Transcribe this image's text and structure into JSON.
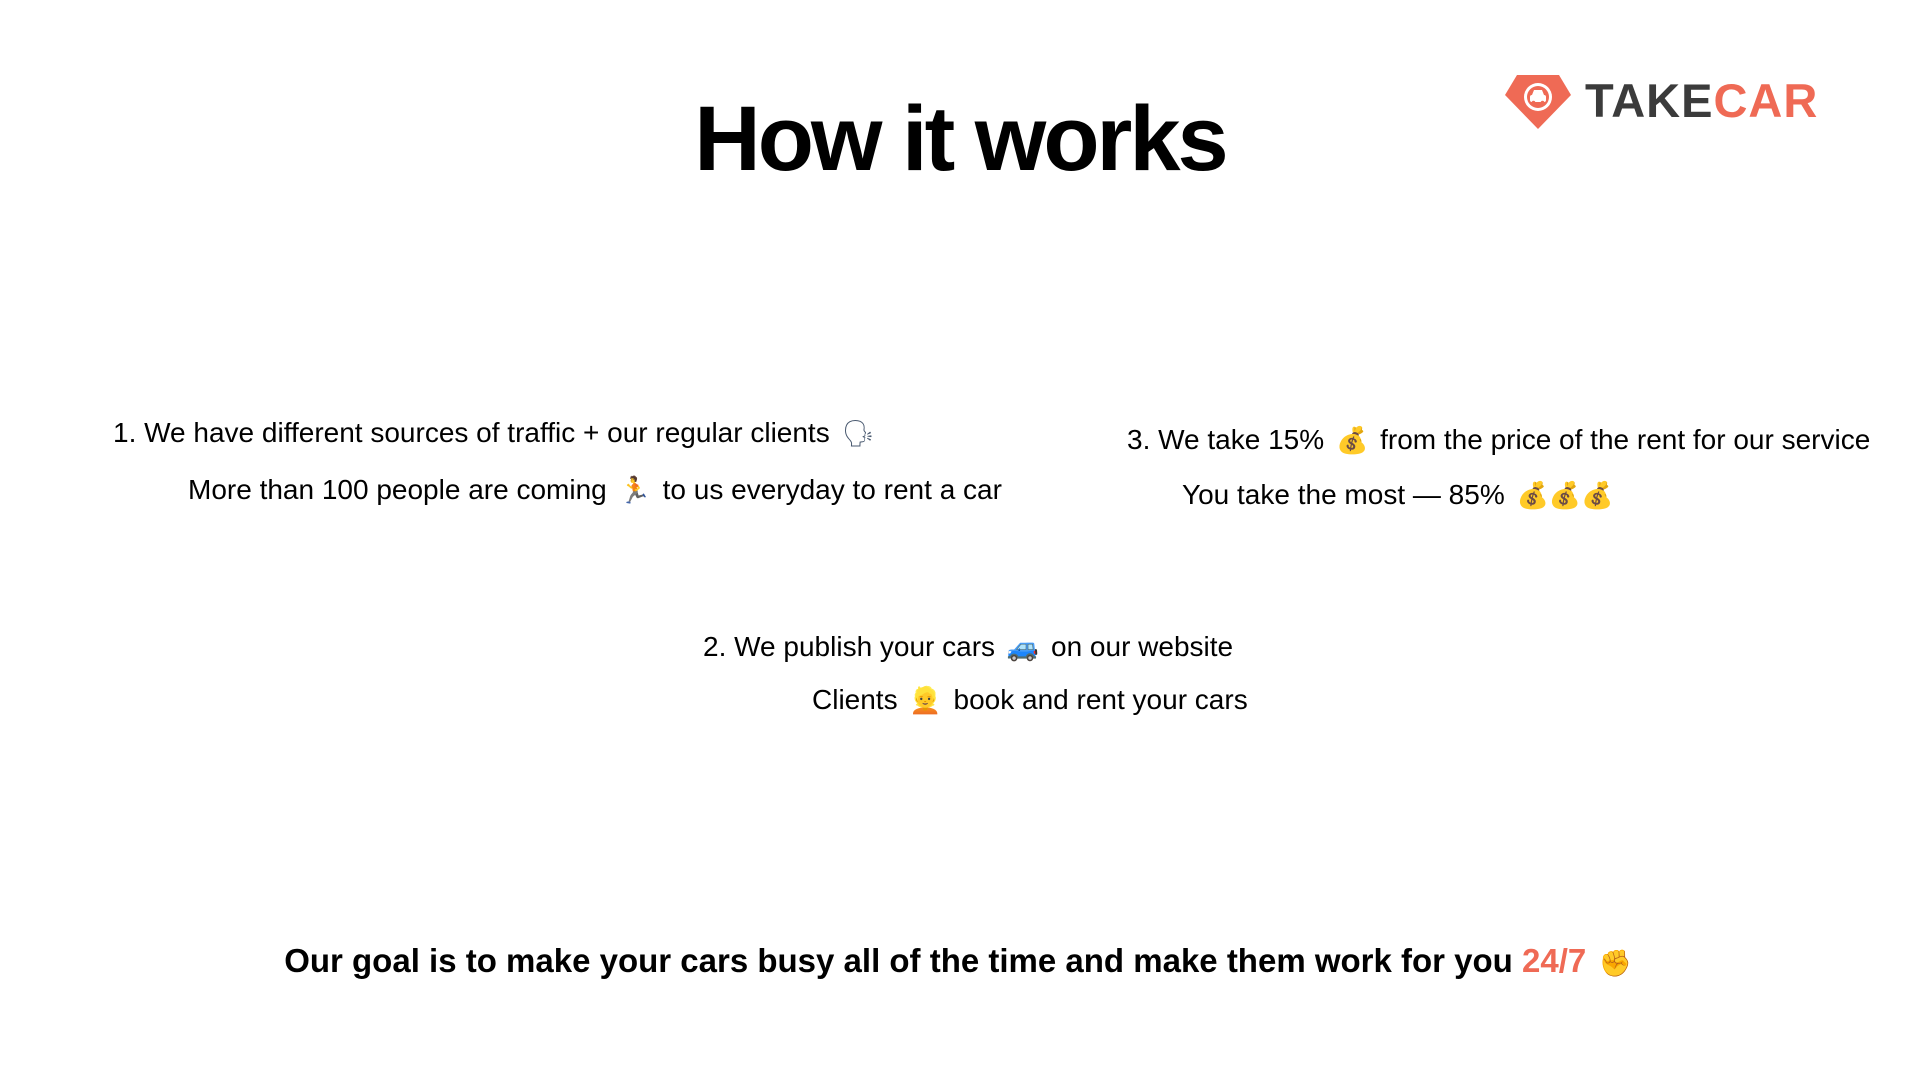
{
  "slide": {
    "title": "How it works",
    "logo": {
      "text_dark": "TAKE",
      "text_accent": "CAR",
      "icon": "car-diamond-logo-icon",
      "accent_color": "#ef6a55",
      "dark_color": "#3b3b3b"
    },
    "step1": {
      "line1": "1. We have different sources of traffic + our regular clients",
      "line1_emoji": "speaking-head-icon",
      "line2_a": "More than 100 people are coming",
      "line2_emoji": "running-person-icon",
      "line2_b": "to us everyday to rent a car"
    },
    "step2": {
      "line1_a": "2. We publish your cars",
      "line1_emoji": "car-icon",
      "line1_b": "on our website",
      "line2_a": "Clients",
      "line2_emoji": "person-face-icon",
      "line2_b": "book and rent your cars"
    },
    "step3": {
      "line1_a": "3. We take 15%",
      "line1_emoji": "money-bag-icon",
      "line1_b": "from the price of the rent for our service",
      "line2_a": "You take the most — 85%",
      "line2_emoji": "money-bags-icon"
    },
    "goal": {
      "text": "Our goal is to make your cars busy all of the time and make them work for you",
      "accent": "24/7",
      "emoji": "raised-fist-icon",
      "accent_color": "#ef6a55"
    }
  }
}
